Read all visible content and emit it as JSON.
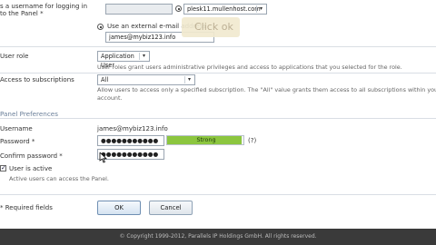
{
  "username_section": {
    "label": "s a username for logging in to the Panel *",
    "radio_label": "Use an external e-mail address",
    "email_value": "james@mybiz123.info",
    "domain_select": "plesk11.mullenhost.com"
  },
  "tooltip": {
    "text": "Click ok"
  },
  "user_role": {
    "label": "User role",
    "value": "Application User",
    "hint": "User roles grant users administrative privileges and access to applications that you selected for the role."
  },
  "subscriptions": {
    "label": "Access to subscriptions",
    "value": "All",
    "hint": "Allow users to access only a specified subscription. The \"All\" value grants them access to all subscriptions within your account."
  },
  "panel_preferences": {
    "title": "Panel Preferences",
    "username_label": "Username",
    "username_value": "james@mybiz123.info",
    "password_label": "Password *",
    "password_value": "●●●●●●●●●●●",
    "strength_label": "Strong",
    "strength_level": 0.98,
    "help_mark": "(?)",
    "confirm_label": "Confirm password *",
    "confirm_value": "●●●●●●●●●●●",
    "active_check": "✓",
    "active_label": "User is active",
    "active_hint": "Active users can access the Panel."
  },
  "form": {
    "required_note": "Required fields",
    "ok_label": "OK",
    "cancel_label": "Cancel"
  },
  "footer": {
    "text": "© Copyright 1999-2012, Parallels IP Holdings GmbH. All rights reserved."
  },
  "colors": {
    "strength_fill": "#8cc63f",
    "section_title": "#6a7f99",
    "footer_bg": "#3a3a3a"
  }
}
